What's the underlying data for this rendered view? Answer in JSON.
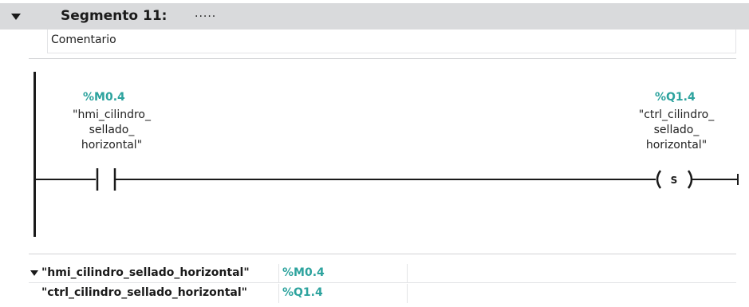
{
  "segment": {
    "title": "Segmento 11:",
    "placeholder": ".....",
    "comment": "Comentario"
  },
  "contact": {
    "address": "%M0.4",
    "name_lines": [
      "\"hmi_cilindro_",
      "sellado_",
      "horizontal\""
    ]
  },
  "coil": {
    "address": "%Q1.4",
    "name_lines": [
      "\"ctrl_cilindro_",
      "sellado_",
      "horizontal\""
    ],
    "type": "S"
  },
  "variables": [
    {
      "name": "\"hmi_cilindro_sellado_horizontal\"",
      "address": "%M0.4"
    },
    {
      "name": "\"ctrl_cilindro_sellado_horizontal\"",
      "address": "%Q1.4"
    }
  ],
  "colors": {
    "address_teal": "#2da39e",
    "header_gray": "#d9dadc",
    "line_black": "#1a1a1a"
  }
}
